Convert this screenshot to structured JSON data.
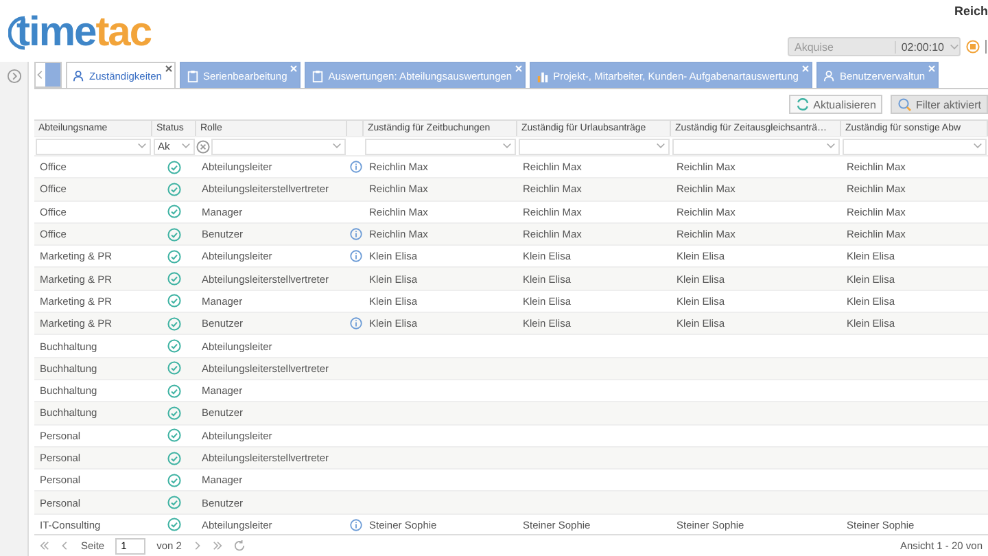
{
  "header": {
    "logo": {
      "first": "time",
      "second": "tac"
    },
    "user": "Reich",
    "timer": {
      "project": "Akquise",
      "time": "02:00:10"
    }
  },
  "tabs": [
    {
      "label": "Zuständigkeiten",
      "kind": "person",
      "selected": true
    },
    {
      "label": "Serienbearbeitung",
      "kind": "clipboard",
      "selected": false
    },
    {
      "label": "Auswertungen: Abteilungsauswertungen",
      "kind": "clipboard",
      "selected": false
    },
    {
      "label": "Projekt-, Mitarbeiter, Kunden- Aufgabenartauswertung",
      "kind": "chart",
      "selected": false
    },
    {
      "label": "Benutzerverwaltun",
      "kind": "person",
      "selected": false
    }
  ],
  "toolbar": {
    "refresh": "Aktualisieren",
    "filter": "Filter aktiviert"
  },
  "table": {
    "columns": [
      "Abteilungsname",
      "Status",
      "Rolle",
      "Zuständig für Zeitbuchungen",
      "Zuständig für Urlaubsanträge",
      "Zuständig für Zeitausgleichsanträ…",
      "Zuständig für sonstige Abw"
    ],
    "status_filter": "Ak",
    "rows": [
      {
        "department": "Office",
        "active": true,
        "role": "Abteilungsleiter",
        "info": true,
        "assignees": [
          "Reichlin Max",
          "Reichlin Max",
          "Reichlin Max",
          "Reichlin Max"
        ]
      },
      {
        "department": "Office",
        "active": true,
        "role": "Abteilungsleiterstellvertreter",
        "info": false,
        "assignees": [
          "Reichlin Max",
          "Reichlin Max",
          "Reichlin Max",
          "Reichlin Max"
        ]
      },
      {
        "department": "Office",
        "active": true,
        "role": "Manager",
        "info": false,
        "assignees": [
          "Reichlin Max",
          "Reichlin Max",
          "Reichlin Max",
          "Reichlin Max"
        ]
      },
      {
        "department": "Office",
        "active": true,
        "role": "Benutzer",
        "info": true,
        "assignees": [
          "Reichlin Max",
          "Reichlin Max",
          "Reichlin Max",
          "Reichlin Max"
        ]
      },
      {
        "department": "Marketing & PR",
        "active": true,
        "role": "Abteilungsleiter",
        "info": true,
        "assignees": [
          "Klein Elisa",
          "Klein Elisa",
          "Klein Elisa",
          "Klein Elisa"
        ]
      },
      {
        "department": "Marketing & PR",
        "active": true,
        "role": "Abteilungsleiterstellvertreter",
        "info": false,
        "assignees": [
          "Klein Elisa",
          "Klein Elisa",
          "Klein Elisa",
          "Klein Elisa"
        ]
      },
      {
        "department": "Marketing & PR",
        "active": true,
        "role": "Manager",
        "info": false,
        "assignees": [
          "Klein Elisa",
          "Klein Elisa",
          "Klein Elisa",
          "Klein Elisa"
        ]
      },
      {
        "department": "Marketing & PR",
        "active": true,
        "role": "Benutzer",
        "info": true,
        "assignees": [
          "Klein Elisa",
          "Klein Elisa",
          "Klein Elisa",
          "Klein Elisa"
        ]
      },
      {
        "department": "Buchhaltung",
        "active": true,
        "role": "Abteilungsleiter",
        "info": false
      },
      {
        "department": "Buchhaltung",
        "active": true,
        "role": "Abteilungsleiterstellvertreter",
        "info": false
      },
      {
        "department": "Buchhaltung",
        "active": true,
        "role": "Manager",
        "info": false
      },
      {
        "department": "Buchhaltung",
        "active": true,
        "role": "Benutzer",
        "info": false
      },
      {
        "department": "Personal",
        "active": true,
        "role": "Abteilungsleiter",
        "info": false
      },
      {
        "department": "Personal",
        "active": true,
        "role": "Abteilungsleiterstellvertreter",
        "info": false
      },
      {
        "department": "Personal",
        "active": true,
        "role": "Manager",
        "info": false
      },
      {
        "department": "Personal",
        "active": true,
        "role": "Benutzer",
        "info": false
      },
      {
        "department": "IT-Consulting",
        "active": true,
        "role": "Abteilungsleiter",
        "info": true,
        "assignees": [
          "Steiner Sophie",
          "Steiner Sophie",
          "Steiner Sophie",
          "Steiner Sophie"
        ]
      }
    ]
  },
  "pager": {
    "page_label": "Seite",
    "page": "1",
    "of": "von 2",
    "summary": "Ansicht 1 - 20 von"
  }
}
